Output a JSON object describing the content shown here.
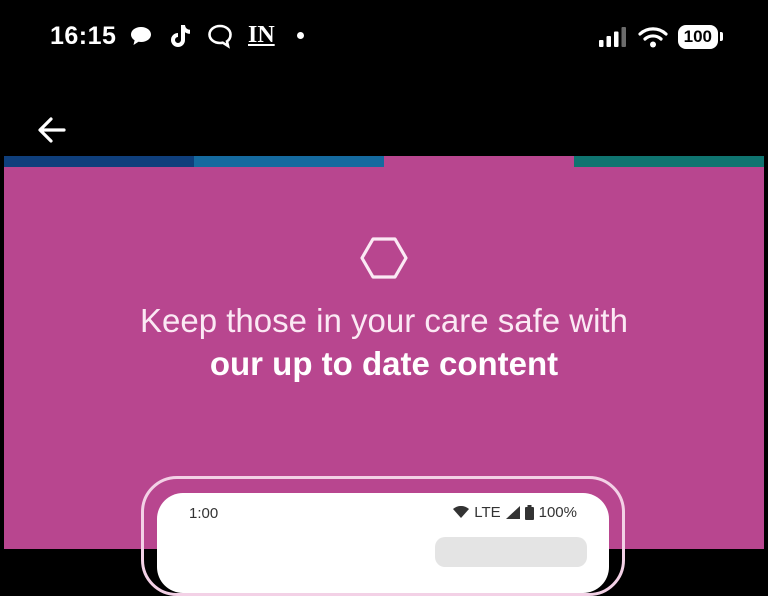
{
  "status_bar": {
    "time": "16:15",
    "notification_icons": [
      "chat-bubble-icon",
      "tiktok-icon",
      "speech-bubble-outline-icon",
      "in-logo-icon"
    ],
    "in_logo_text": "IN",
    "battery": "100"
  },
  "app_bar": {
    "back_icon": "arrow-left-icon"
  },
  "progress_segments": [
    "#0f3f7c",
    "#156a9f",
    "#b8468f",
    "#0f7470"
  ],
  "onboarding": {
    "icon": "hexagon-icon",
    "headline_line1": "Keep those in your care safe with",
    "headline_line2": "our up to date content",
    "accent_color": "#b8468f"
  },
  "phone_preview": {
    "time": "1:00",
    "network": "LTE",
    "battery": "100%"
  }
}
